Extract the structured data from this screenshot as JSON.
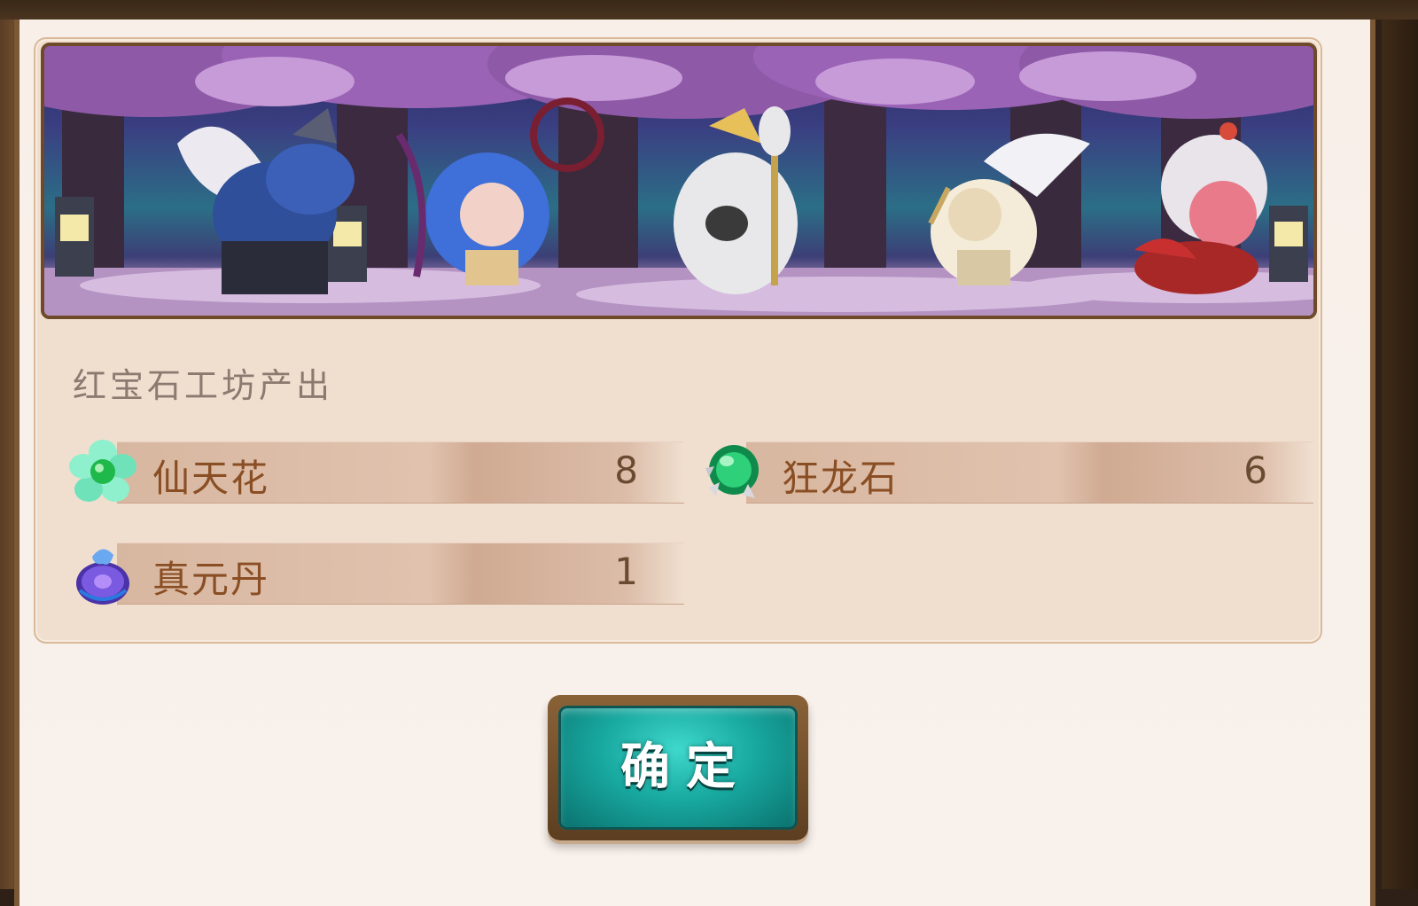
{
  "dialog": {
    "section_title": "红宝石工坊产出",
    "confirm_label": "确定"
  },
  "rewards": [
    {
      "name": "仙天花",
      "count": "8",
      "icon": "jade-flower-icon",
      "color": "#5fe0b8"
    },
    {
      "name": "狂龙石",
      "count": "6",
      "icon": "dragon-stone-icon",
      "color": "#1fb36a"
    },
    {
      "name": "真元丹",
      "count": "1",
      "icon": "essence-pill-icon",
      "color": "#6a4cd0"
    }
  ],
  "colors": {
    "panel_bg": "#f0dfcf",
    "text_brown": "#8a4e24",
    "confirm_teal": "#18a9a0"
  }
}
